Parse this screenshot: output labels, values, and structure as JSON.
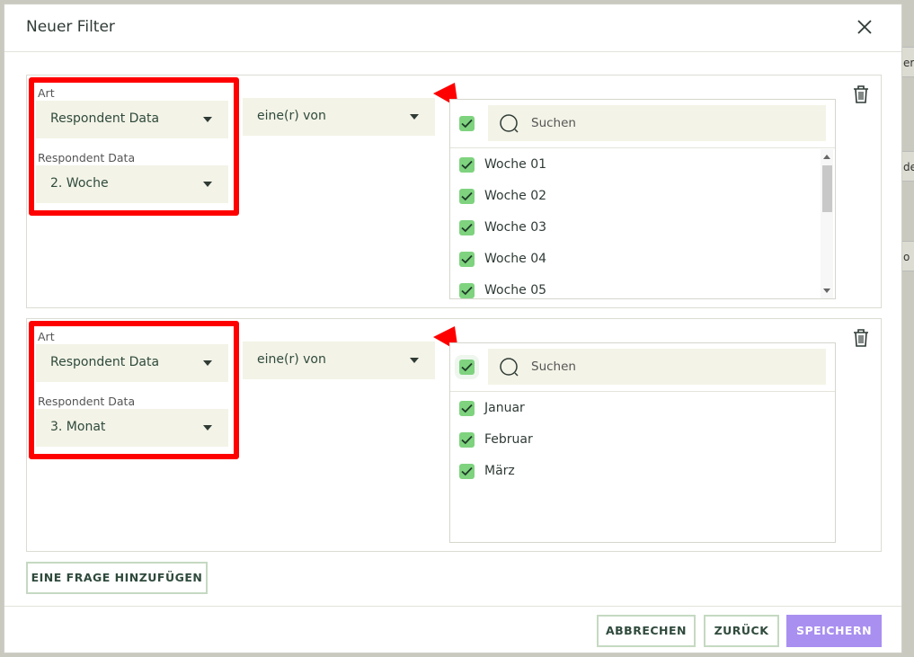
{
  "background": {
    "peek_right_1": "erf",
    "peek_right_2": "de",
    "peek_right_3": "o"
  },
  "dialog": {
    "title": "Neuer Filter",
    "close_icon": "close-icon"
  },
  "filters": [
    {
      "art_label": "Art",
      "art_value": "Respondent Data",
      "sub_label": "Respondent Data",
      "sub_value": "2. Woche",
      "operator_value": "eine(r) von",
      "search_placeholder": "Suchen",
      "select_all_checked": true,
      "options": [
        {
          "label": "Woche 01",
          "checked": true
        },
        {
          "label": "Woche 02",
          "checked": true
        },
        {
          "label": "Woche 03",
          "checked": true
        },
        {
          "label": "Woche 04",
          "checked": true
        },
        {
          "label": "Woche 05",
          "checked": true
        }
      ]
    },
    {
      "art_label": "Art",
      "art_value": "Respondent Data",
      "sub_label": "Respondent Data",
      "sub_value": "3. Monat",
      "operator_value": "eine(r) von",
      "search_placeholder": "Suchen",
      "select_all_checked": true,
      "options": [
        {
          "label": "Januar",
          "checked": true
        },
        {
          "label": "Februar",
          "checked": true
        },
        {
          "label": "März",
          "checked": true
        }
      ]
    }
  ],
  "actions": {
    "add_question": "EINE FRAGE HINZUFÜGEN",
    "cancel": "ABBRECHEN",
    "back": "ZURÜCK",
    "save": "SPEICHERN"
  },
  "colors": {
    "accent_primary": "#a98ff0",
    "checkbox_green": "#7fd37f",
    "select_bg": "#f3f3e7",
    "annotation_red": "#ff0000"
  }
}
